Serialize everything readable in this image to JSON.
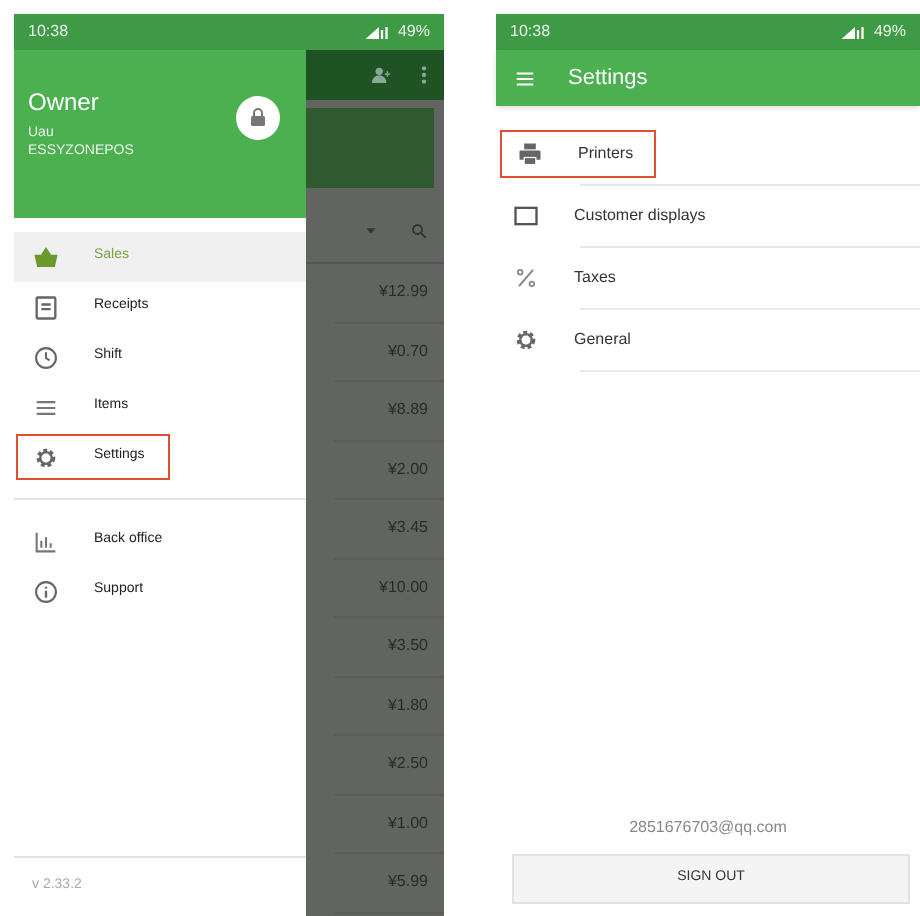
{
  "left_screen": {
    "status_bar": {
      "time": "10:38",
      "battery": "49%"
    },
    "drawer": {
      "user_name": "Owner",
      "user_role": "Uau",
      "store": "ESSYZONEPOS",
      "sections": [
        {
          "items": [
            {
              "label": "Sales",
              "kind": "basket",
              "selected": true,
              "highlighted": false
            },
            {
              "label": "Receipts",
              "kind": "receipt",
              "selected": false,
              "highlighted": false
            },
            {
              "label": "Shift",
              "kind": "clock",
              "selected": false,
              "highlighted": false
            },
            {
              "label": "Items",
              "kind": "list",
              "selected": false,
              "highlighted": false
            },
            {
              "label": "Settings",
              "kind": "gear",
              "selected": false,
              "highlighted": true
            }
          ]
        },
        {
          "items": [
            {
              "label": "Back office",
              "kind": "chart",
              "selected": false,
              "highlighted": false
            },
            {
              "label": "Support",
              "kind": "info",
              "selected": false,
              "highlighted": false
            }
          ]
        }
      ],
      "version": "v 2.33.2"
    },
    "background": {
      "prices": [
        "¥12.99",
        "¥0.70",
        "¥8.89",
        "¥2.00",
        "¥3.45",
        "¥10.00",
        "¥3.50",
        "¥1.80",
        "¥2.50",
        "¥1.00",
        "¥5.99"
      ]
    }
  },
  "right_screen": {
    "status_bar": {
      "time": "10:38",
      "battery": "49%"
    },
    "title": "Settings",
    "items": [
      {
        "label": "Printers",
        "kind": "printer",
        "highlighted": true
      },
      {
        "label": "Customer displays",
        "kind": "display",
        "highlighted": false
      },
      {
        "label": "Taxes",
        "kind": "percent",
        "highlighted": false
      },
      {
        "label": "General",
        "kind": "gear",
        "highlighted": false
      }
    ],
    "email": "2851676703@qq.com",
    "sign_out": "SIGN OUT"
  }
}
